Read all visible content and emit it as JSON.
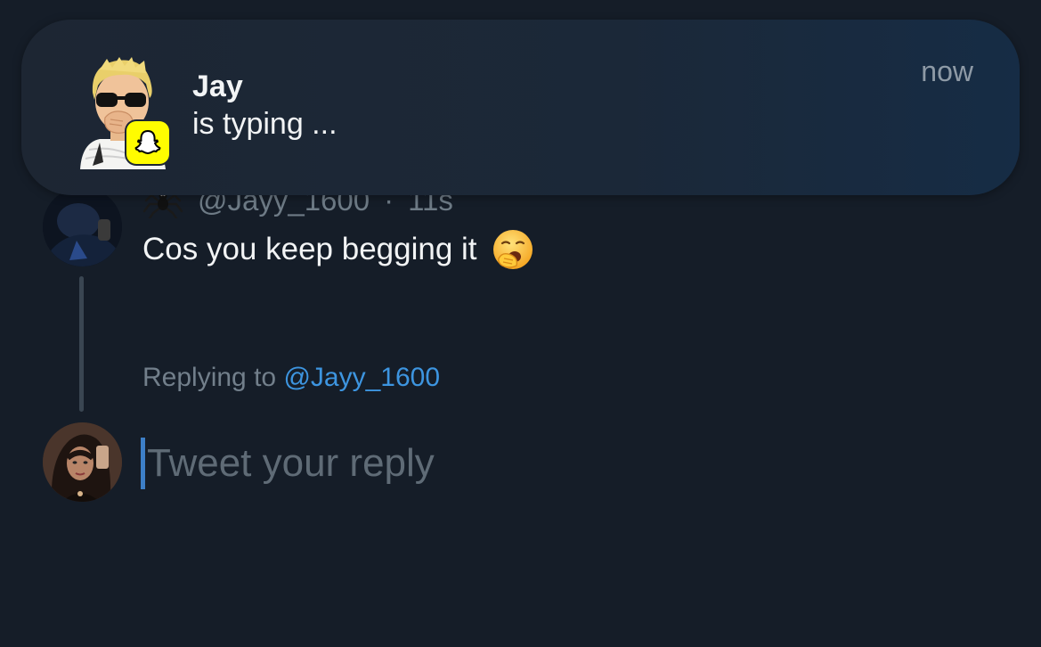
{
  "notification": {
    "title": "Jay",
    "body": "is typing ...",
    "time": "now",
    "app_icon": "snapchat-ghost-icon"
  },
  "tweet": {
    "handle": "@Jayy_1600",
    "separator": "·",
    "time": "11s",
    "text": "Cos you keep begging it",
    "emoji_icon": "yawning-face-icon",
    "name_icon": "spider-icon"
  },
  "reply": {
    "prefix": "Replying to",
    "handle": "@Jayy_1600",
    "placeholder": "Tweet your reply"
  },
  "colors": {
    "background": "#151d28",
    "link": "#3d95e0",
    "snapchat_yellow": "#fffc00"
  }
}
